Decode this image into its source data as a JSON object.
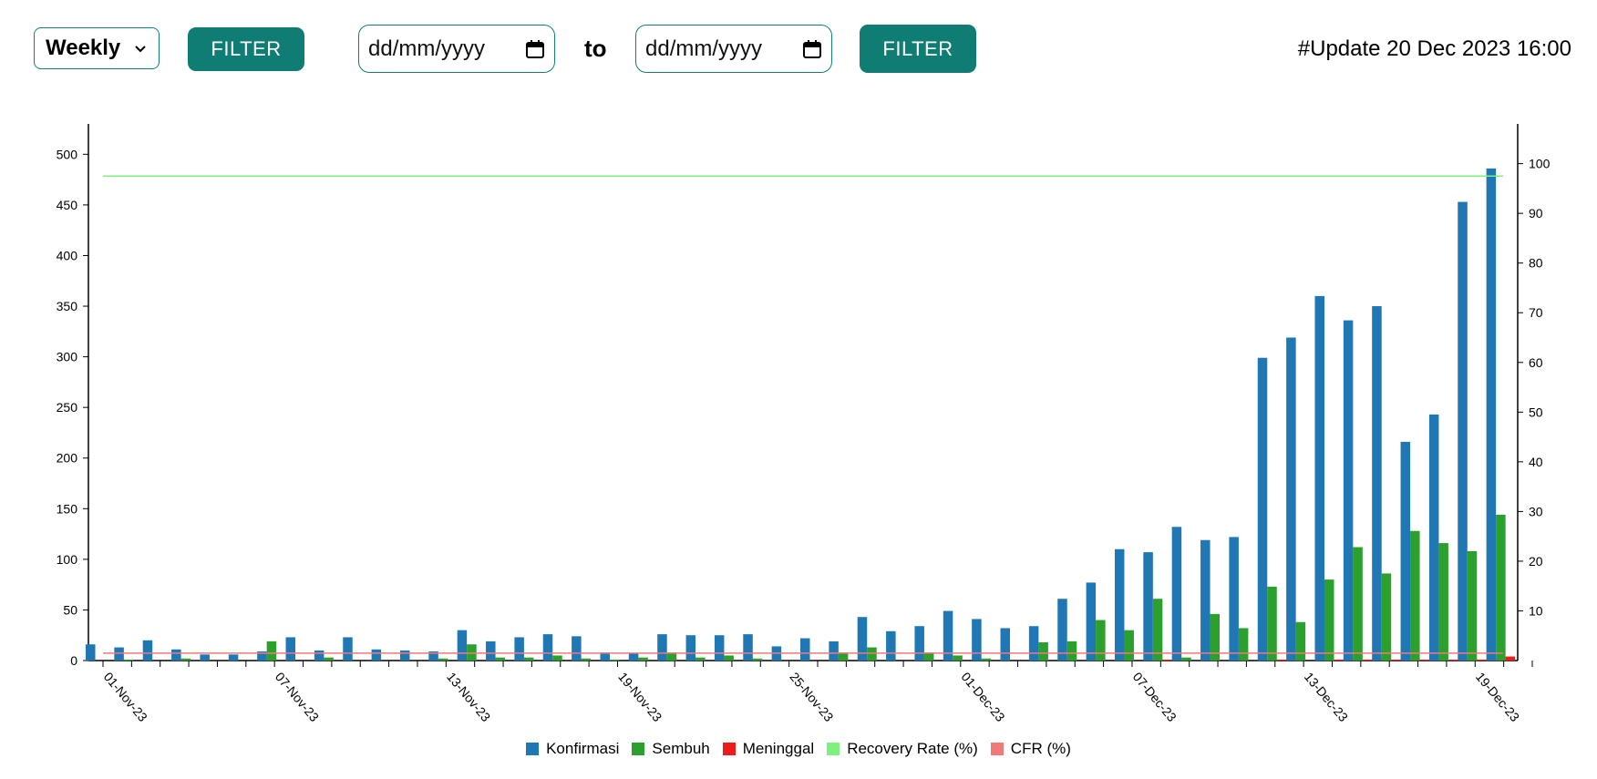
{
  "controls": {
    "period_select": "Weekly",
    "filter1": "FILTER",
    "date_from_placeholder": "dd/mm/yyyy",
    "to_label": "to",
    "date_to_placeholder": "dd/mm/yyyy",
    "filter2": "FILTER",
    "update": "#Update 20 Dec 2023 16:00",
    "accent": "#0f7d74"
  },
  "chart_data": {
    "type": "bar",
    "left_axis": {
      "min": 0,
      "max": 530,
      "ticks": [
        0,
        50,
        100,
        150,
        200,
        250,
        300,
        350,
        400,
        450,
        500
      ]
    },
    "right_axis": {
      "min": 0,
      "max": 108,
      "ticks": [
        10,
        20,
        30,
        40,
        50,
        60,
        70,
        80,
        90,
        100
      ]
    },
    "x_tick_labels": [
      {
        "index": 0,
        "label": "01-Nov-23"
      },
      {
        "index": 6,
        "label": "07-Nov-23"
      },
      {
        "index": 12,
        "label": "13-Nov-23"
      },
      {
        "index": 18,
        "label": "19-Nov-23"
      },
      {
        "index": 24,
        "label": "25-Nov-23"
      },
      {
        "index": 30,
        "label": "01-Dec-23"
      },
      {
        "index": 36,
        "label": "07-Dec-23"
      },
      {
        "index": 42,
        "label": "13-Dec-23"
      },
      {
        "index": 48,
        "label": "19-Dec-23"
      }
    ],
    "categories_count": 50,
    "series": [
      {
        "name": "Konfirmasi",
        "color": "#1f77b4",
        "axis": "left",
        "values": [
          16,
          13,
          20,
          11,
          6,
          6,
          9,
          23,
          10,
          23,
          11,
          10,
          9,
          30,
          19,
          23,
          26,
          24,
          8,
          7,
          26,
          25,
          25,
          26,
          14,
          22,
          19,
          43,
          29,
          34,
          49,
          41,
          32,
          34,
          61,
          77,
          110,
          107,
          132,
          119,
          122,
          299,
          319,
          360,
          336,
          350,
          216,
          243,
          453,
          486
        ]
      },
      {
        "name": "Sembuh",
        "color": "#2ca02c",
        "axis": "left",
        "values": [
          0,
          1,
          0,
          2,
          0,
          0,
          19,
          0,
          3,
          0,
          0,
          0,
          2,
          16,
          3,
          3,
          5,
          2,
          1,
          3,
          8,
          3,
          5,
          2,
          0,
          0,
          8,
          13,
          0,
          8,
          5,
          2,
          0,
          18,
          19,
          40,
          30,
          61,
          3,
          46,
          32,
          73,
          38,
          80,
          112,
          86,
          128,
          116,
          108,
          144
        ]
      },
      {
        "name": "Meninggal",
        "color": "#ee1c1c",
        "axis": "left",
        "values": [
          0,
          0,
          0,
          0,
          0,
          0,
          0,
          0,
          0,
          0,
          0,
          0,
          0,
          0,
          0,
          0,
          0,
          0,
          0,
          0,
          0,
          0,
          0,
          0,
          0,
          0,
          0,
          0,
          0,
          0,
          0,
          0,
          0,
          0,
          0,
          0,
          0,
          1,
          0,
          0,
          0,
          1,
          0,
          1,
          1,
          1,
          1,
          1,
          1,
          4
        ]
      },
      {
        "name": "Recovery Rate (%)",
        "color": "#7ef07e",
        "axis": "right",
        "type": "line",
        "values_const": 97.5
      },
      {
        "name": "CFR (%)",
        "color": "#f07a7a",
        "axis": "right",
        "type": "line",
        "values_const": 1.5
      }
    ]
  }
}
